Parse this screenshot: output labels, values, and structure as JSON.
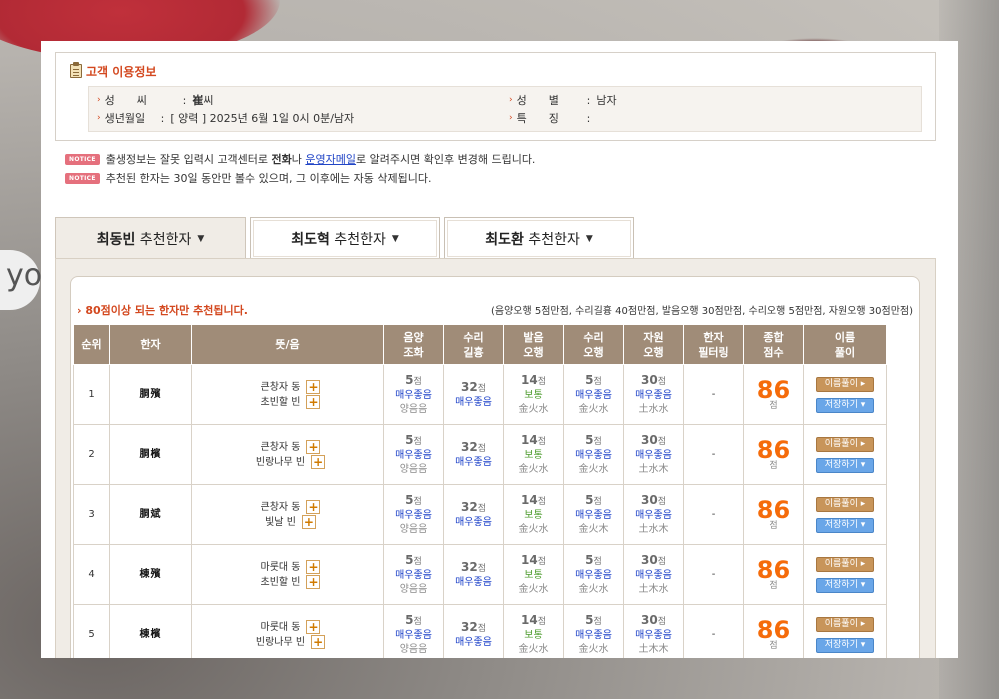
{
  "background_text": "yo",
  "info": {
    "title": "고객 이용정보",
    "rows": [
      {
        "label": "성　　씨",
        "value": "崔씨",
        "value_bold": "崔"
      },
      {
        "label": "생년월일",
        "value": "[ 양력 ] 2025년 6월 1일 0시 0분/남자"
      },
      {
        "label": "성　　별",
        "value": "남자"
      },
      {
        "label": "특　　징",
        "value": ""
      }
    ]
  },
  "notices": [
    {
      "badge": "NOTICE",
      "pre": "출생정보는 잘못 입력시 고객센터로 ",
      "b1": "전화",
      "mid": "나 ",
      "link": "운영자메일",
      "post": "로 알려주시면 확인후 변경해 드립니다."
    },
    {
      "badge": "NOTICE",
      "text": "추천된 한자는 30일 동안만 볼수 있으며, 그 이후에는 자동 삭제됩니다."
    }
  ],
  "tabs": [
    {
      "name_bold": "최동빈",
      "suffix": " 추천한자",
      "active": true
    },
    {
      "name_bold": "최도혁",
      "suffix": " 추천한자",
      "active": false
    },
    {
      "name_bold": "최도환",
      "suffix": " 추천한자",
      "active": false
    }
  ],
  "panel": {
    "head_left": "80점이상 되는 한자만 추천됩니다.",
    "head_right": "(음양오행 5점만점, 수리길흉 40점만점, 발음오행 30점만점, 수리오행 5점만점, 자원오행 30점만점)"
  },
  "table": {
    "headers": [
      "순위",
      "한자",
      "뜻/음",
      "음양\n조화",
      "수리\n길흉",
      "발음\n오행",
      "수리\n오행",
      "자원\n오행",
      "한자\n필터링",
      "종합\n점수",
      "이름\n풀이"
    ],
    "point_unit": "점",
    "explain_label": "이름풀이 ▸",
    "save_label": "저장하기 ▾",
    "rows": [
      {
        "rank": "1",
        "hanja": "胴殯",
        "m1": "큰창자 동",
        "m2": "초빈할 빈",
        "yy": {
          "pt": "5",
          "lv": "매우좋음",
          "sub": "양음음"
        },
        "sr": {
          "pt": "32",
          "lv": "매우좋음"
        },
        "bo": {
          "pt": "14",
          "lv": "보통",
          "sub": "金火水"
        },
        "so": {
          "pt": "5",
          "lv": "매우좋음",
          "sub": "金火水"
        },
        "jo": {
          "pt": "30",
          "lv": "매우좋음",
          "sub": "土水水"
        },
        "filter": "-",
        "total": "86"
      },
      {
        "rank": "2",
        "hanja": "胴檳",
        "m1": "큰창자 동",
        "m2": "빈랑나무 빈",
        "yy": {
          "pt": "5",
          "lv": "매우좋음",
          "sub": "양음음"
        },
        "sr": {
          "pt": "32",
          "lv": "매우좋음"
        },
        "bo": {
          "pt": "14",
          "lv": "보통",
          "sub": "金火水"
        },
        "so": {
          "pt": "5",
          "lv": "매우좋음",
          "sub": "金火水"
        },
        "jo": {
          "pt": "30",
          "lv": "매우좋음",
          "sub": "土水木"
        },
        "filter": "-",
        "total": "86"
      },
      {
        "rank": "3",
        "hanja": "胴斌",
        "m1": "큰창자 동",
        "m2": "빛날 빈",
        "yy": {
          "pt": "5",
          "lv": "매우좋음",
          "sub": "양음음"
        },
        "sr": {
          "pt": "32",
          "lv": "매우좋음"
        },
        "bo": {
          "pt": "14",
          "lv": "보통",
          "sub": "金火水"
        },
        "so": {
          "pt": "5",
          "lv": "매우좋음",
          "sub": "金火木"
        },
        "jo": {
          "pt": "30",
          "lv": "매우좋음",
          "sub": "土水木"
        },
        "filter": "-",
        "total": "86"
      },
      {
        "rank": "4",
        "hanja": "棟殯",
        "m1": "마룻대 동",
        "m2": "초빈할 빈",
        "yy": {
          "pt": "5",
          "lv": "매우좋음",
          "sub": "양음음"
        },
        "sr": {
          "pt": "32",
          "lv": "매우좋음"
        },
        "bo": {
          "pt": "14",
          "lv": "보통",
          "sub": "金火水"
        },
        "so": {
          "pt": "5",
          "lv": "매우좋음",
          "sub": "金火水"
        },
        "jo": {
          "pt": "30",
          "lv": "매우좋음",
          "sub": "土木水"
        },
        "filter": "-",
        "total": "86"
      },
      {
        "rank": "5",
        "hanja": "棟檳",
        "m1": "마룻대 동",
        "m2": "빈랑나무 빈",
        "yy": {
          "pt": "5",
          "lv": "매우좋음",
          "sub": "양음음"
        },
        "sr": {
          "pt": "32",
          "lv": "매우좋음"
        },
        "bo": {
          "pt": "14",
          "lv": "보통",
          "sub": "金火水"
        },
        "so": {
          "pt": "5",
          "lv": "매우좋음",
          "sub": "金火水"
        },
        "jo": {
          "pt": "30",
          "lv": "매우좋음",
          "sub": "土木木"
        },
        "filter": "-",
        "total": "86"
      }
    ]
  }
}
